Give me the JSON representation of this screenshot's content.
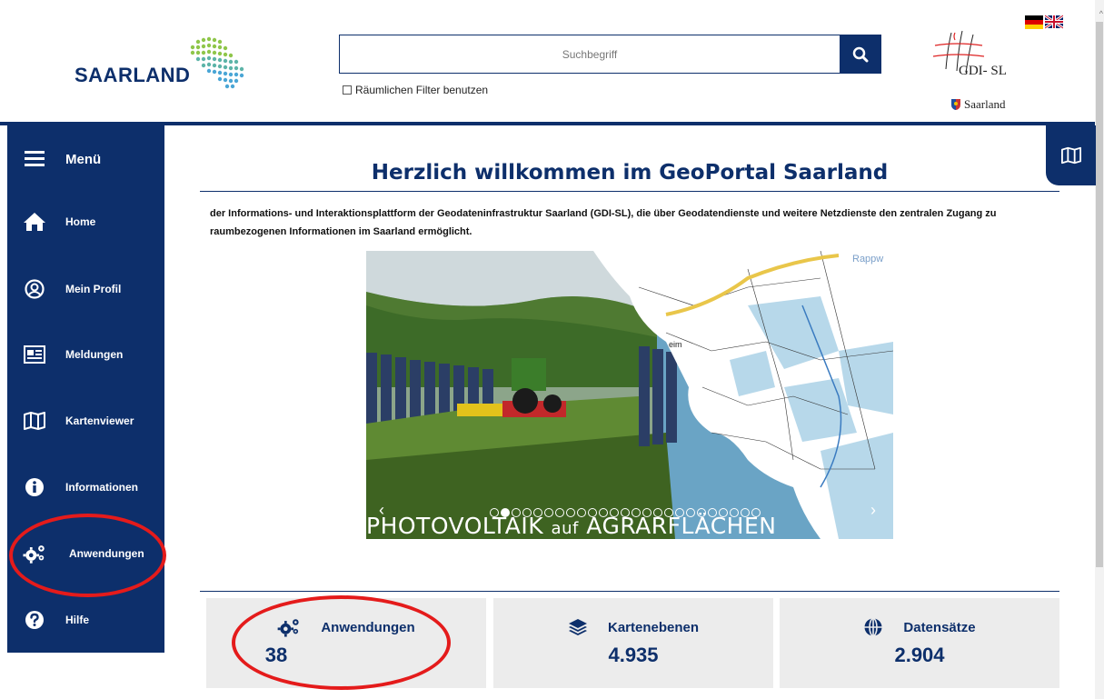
{
  "header": {
    "logo_text": "SAARLAND",
    "search_placeholder": "Suchbegriff",
    "filter_label": "Räumlichen Filter benutzen",
    "gdi_label": "GDI- SL",
    "gdi_region": "Saarland"
  },
  "sidebar": {
    "menu_label": "Menü",
    "items": [
      {
        "label": "Home",
        "icon": "home-icon"
      },
      {
        "label": "Mein Profil",
        "icon": "user-icon"
      },
      {
        "label": "Meldungen",
        "icon": "news-icon"
      },
      {
        "label": "Kartenviewer",
        "icon": "map-icon"
      },
      {
        "label": "Informationen",
        "icon": "info-icon"
      },
      {
        "label": "Anwendungen",
        "icon": "gears-icon"
      },
      {
        "label": "Hilfe",
        "icon": "help-icon"
      }
    ]
  },
  "main": {
    "title": "Herzlich willkommen im GeoPortal Saarland",
    "intro": "der Informations- und Interaktionsplattform der Geodateninfrastruktur Saarland (GDI-SL), die über Geodatendienste und weitere Netzdienste den zentralen Zugang zu raumbezogenen Informationen im Saarland ermöglicht.",
    "slider": {
      "caption_a": "PHOTOVOLTAIK",
      "caption_b": "auf",
      "caption_c": "AGRARFLÄCHEN",
      "prev": "‹",
      "next": "›",
      "map_label": "Rappw",
      "map_label2": "eim"
    },
    "stats": [
      {
        "label": "Anwendungen",
        "value": "38",
        "icon": "gears-icon"
      },
      {
        "label": "Kartenebenen",
        "value": "4.935",
        "icon": "layers-icon"
      },
      {
        "label": "Datensätze",
        "value": "2.904",
        "icon": "globe-icon"
      }
    ]
  },
  "colors": {
    "brand": "#0d2f6b",
    "annotation": "#e41b1b",
    "card": "#ececec"
  }
}
